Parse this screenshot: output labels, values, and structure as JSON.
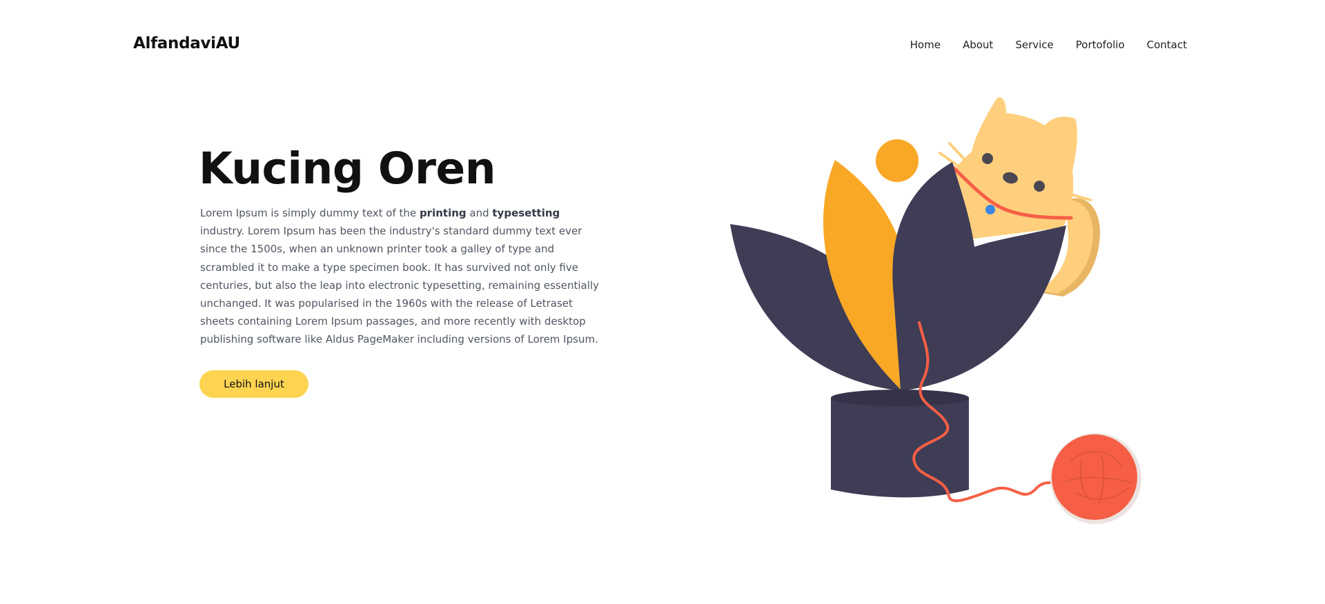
{
  "header": {
    "logo": "AlfandaviAU",
    "nav": [
      {
        "label": "Home"
      },
      {
        "label": "About"
      },
      {
        "label": "Service"
      },
      {
        "label": "Portofolio"
      },
      {
        "label": "Contact"
      }
    ]
  },
  "hero": {
    "title": "Kucing Oren",
    "paragraph": {
      "part1": "Lorem Ipsum is simply dummy text of the ",
      "bold1": "printing",
      "part2": " and ",
      "bold2": "typesetting",
      "part3": " industry. Lorem Ipsum has been the industry's standard dummy text ever since the 1500s, when an unknown printer took a galley of type and scrambled it to make a type specimen book. It has survived not only five centuries, but also the leap into electronic typesetting, remaining essentially unchanged. It was popularised in the 1960s with the release of Letraset sheets containing Lorem Ipsum passages, and more recently with desktop publishing software like Aldus PageMaker including versions of Lorem Ipsum."
    },
    "button_label": "Lebih lanjut"
  },
  "colors": {
    "accent_yellow": "#fdd451",
    "plant_dark": "#3f3d56",
    "leaf_orange": "#f9a826",
    "cat_body": "#ffcf7d",
    "yarn_red": "#f65f45"
  },
  "illustration": {
    "icon": "cat-in-plant-pot-illustration"
  }
}
